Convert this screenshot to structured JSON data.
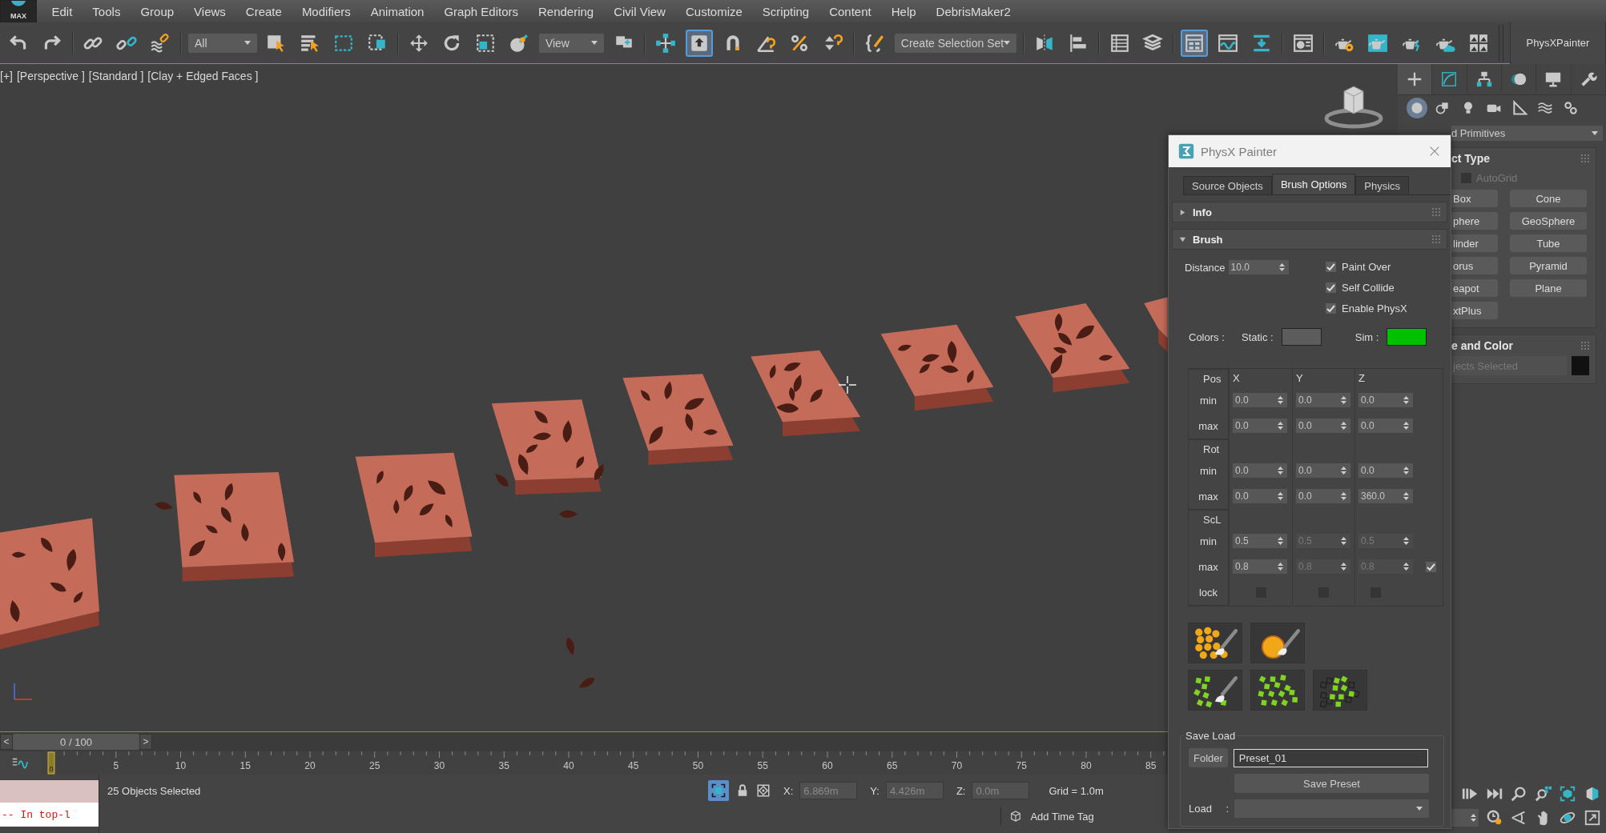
{
  "app_button": {
    "label": "MAX"
  },
  "menu_bar": [
    {
      "label": "Edit"
    },
    {
      "label": "Tools"
    },
    {
      "label": "Group"
    },
    {
      "label": "Views"
    },
    {
      "label": "Create"
    },
    {
      "label": "Modifiers"
    },
    {
      "label": "Animation"
    },
    {
      "label": "Graph Editors"
    },
    {
      "label": "Rendering"
    },
    {
      "label": "Civil View"
    },
    {
      "label": "Customize"
    },
    {
      "label": "Scripting"
    },
    {
      "label": "Content"
    },
    {
      "label": "Help"
    },
    {
      "label": "DebrisMaker2"
    }
  ],
  "main_toolbar": {
    "items": [
      {
        "kind": "icon",
        "selected": false
      },
      {
        "kind": "icon",
        "selected": false
      },
      {
        "kind": "separator"
      },
      {
        "kind": "icon",
        "selected": false
      },
      {
        "kind": "icon",
        "selected": false
      },
      {
        "kind": "icon",
        "selected": false
      },
      {
        "kind": "separator"
      },
      {
        "kind": "dropdown",
        "value": "All"
      },
      {
        "kind": "icon",
        "selected": false
      },
      {
        "kind": "icon",
        "selected": false
      },
      {
        "kind": "icon",
        "selected": false
      },
      {
        "kind": "icon",
        "selected": false
      },
      {
        "kind": "separator"
      },
      {
        "kind": "icon",
        "selected": false
      },
      {
        "kind": "icon",
        "selected": false
      },
      {
        "kind": "icon",
        "selected": false
      },
      {
        "kind": "icon",
        "selected": false
      },
      {
        "kind": "dropdown",
        "value": "View"
      },
      {
        "kind": "icon",
        "selected": false
      },
      {
        "kind": "separator"
      },
      {
        "kind": "icon",
        "selected": false
      },
      {
        "kind": "icon",
        "selected": true
      },
      {
        "kind": "icon",
        "selected": false
      },
      {
        "kind": "icon",
        "selected": false
      },
      {
        "kind": "icon",
        "selected": false
      },
      {
        "kind": "icon",
        "selected": false
      },
      {
        "kind": "separator"
      },
      {
        "kind": "icon",
        "selected": false
      },
      {
        "kind": "dropdown",
        "value": "Create Selection Set"
      },
      {
        "kind": "separator"
      },
      {
        "kind": "icon",
        "selected": false
      },
      {
        "kind": "icon",
        "selected": false
      },
      {
        "kind": "separator"
      },
      {
        "kind": "icon",
        "selected": false
      },
      {
        "kind": "icon",
        "selected": false
      },
      {
        "kind": "separator"
      },
      {
        "kind": "icon",
        "selected": true
      },
      {
        "kind": "icon",
        "selected": false
      },
      {
        "kind": "icon",
        "selected": false
      },
      {
        "kind": "separator"
      },
      {
        "kind": "icon",
        "selected": false
      },
      {
        "kind": "separator"
      },
      {
        "kind": "icon",
        "selected": false
      },
      {
        "kind": "icon",
        "selected": false
      },
      {
        "kind": "icon",
        "selected": false
      },
      {
        "kind": "icon",
        "selected": false
      },
      {
        "kind": "icon",
        "selected": false
      }
    ],
    "tab_label": "PhysXPainter"
  },
  "viewport": {
    "labels": [
      "[+]",
      "[Perspective ]",
      "[Standard ]",
      "[Clay + Edged Faces ]"
    ]
  },
  "command_panel": {
    "tabs": [
      {
        "selected": true
      },
      {
        "selected": false
      },
      {
        "selected": false
      },
      {
        "selected": false
      },
      {
        "selected": false
      },
      {
        "selected": false
      }
    ],
    "categories": [
      {
        "selected": true
      },
      {
        "selected": false
      },
      {
        "selected": false
      },
      {
        "selected": false
      },
      {
        "selected": false
      },
      {
        "selected": false
      },
      {
        "selected": false
      }
    ],
    "category_dropdown": "d Primitives",
    "object_type": {
      "title": "ct Type",
      "autogrid": {
        "label": "AutoGrid",
        "checked": false,
        "disabled": true
      },
      "buttons": [
        {
          "label": "Box"
        },
        {
          "label": "Cone"
        },
        {
          "label": "phere"
        },
        {
          "label": "GeoSphere"
        },
        {
          "label": "linder"
        },
        {
          "label": "Tube"
        },
        {
          "label": "orus"
        },
        {
          "label": "Pyramid"
        },
        {
          "label": "eapot"
        },
        {
          "label": "Plane"
        },
        {
          "label": "xtPlus"
        }
      ]
    },
    "name_color": {
      "title": "e and Color",
      "name_field": {
        "value": "jects Selected",
        "disabled": true
      },
      "color": "#111111"
    }
  },
  "physx_painter": {
    "title": "PhysX Painter",
    "tabs": [
      {
        "label": "Source Objects",
        "selected": false
      },
      {
        "label": "Brush Options",
        "selected": true
      },
      {
        "label": "Physics",
        "selected": false
      }
    ],
    "rollouts": [
      {
        "title": "Info",
        "expanded": false
      },
      {
        "title": "Brush",
        "expanded": true,
        "brush": {
          "distance": {
            "label": "Distance",
            "value": "10.0"
          },
          "options": [
            {
              "label": "Paint Over",
              "checked": true
            },
            {
              "label": "Self Collide",
              "checked": true
            },
            {
              "label": "Enable PhysX",
              "checked": true
            }
          ],
          "colors": {
            "label": "Colors :",
            "swatches": [
              {
                "label": "Static :",
                "color": "#5c5c5c"
              },
              {
                "label": "Sim :",
                "color": "#00c000"
              }
            ]
          },
          "limits": {
            "columns": [
              "X",
              "Y",
              "Z"
            ],
            "groups": [
              {
                "label": "Pos",
                "rows": [
                  {
                    "label": "min",
                    "values": [
                      {
                        "value": "0.0",
                        "disabled": false
                      },
                      {
                        "value": "0.0",
                        "disabled": false
                      },
                      {
                        "value": "0.0",
                        "disabled": false
                      }
                    ]
                  },
                  {
                    "label": "max",
                    "values": [
                      {
                        "value": "0.0",
                        "disabled": false
                      },
                      {
                        "value": "0.0",
                        "disabled": false
                      },
                      {
                        "value": "0.0",
                        "disabled": false
                      }
                    ]
                  }
                ]
              },
              {
                "label": "Rot",
                "rows": [
                  {
                    "label": "min",
                    "values": [
                      {
                        "value": "0.0",
                        "disabled": false
                      },
                      {
                        "value": "0.0",
                        "disabled": false
                      },
                      {
                        "value": "0.0",
                        "disabled": false
                      }
                    ]
                  },
                  {
                    "label": "max",
                    "values": [
                      {
                        "value": "0.0",
                        "disabled": false
                      },
                      {
                        "value": "0.0",
                        "disabled": false
                      },
                      {
                        "value": "360.0",
                        "disabled": false
                      }
                    ]
                  }
                ]
              },
              {
                "label": "ScL",
                "rows": [
                  {
                    "label": "min",
                    "values": [
                      {
                        "value": "0.5",
                        "disabled": false
                      },
                      {
                        "value": "0.5",
                        "disabled": true
                      },
                      {
                        "value": "0.5",
                        "disabled": true
                      }
                    ]
                  },
                  {
                    "label": "max",
                    "values": [
                      {
                        "value": "0.8",
                        "disabled": false
                      },
                      {
                        "value": "0.8",
                        "disabled": true
                      },
                      {
                        "value": "0.8",
                        "disabled": true
                      }
                    ],
                    "check": true
                  }
                ],
                "lock": {
                  "label": "lock",
                  "checks": [
                    {
                      "checked": false
                    },
                    {
                      "checked": false
                    },
                    {
                      "checked": false
                    }
                  ]
                }
              }
            ]
          },
          "tools": [
            [
              {
                "kind": "paint-dots"
              },
              {
                "kind": "paint-circle"
              }
            ],
            [
              {
                "kind": "paint-squares"
              },
              {
                "kind": "scatter-squares"
              },
              {
                "kind": "erase-squares"
              }
            ]
          ],
          "save_load": {
            "title": "Save Load",
            "folder_button": "Folder",
            "preset_name": "Preset_01",
            "save_button": "Save Preset",
            "load_label": "Load :"
          }
        }
      }
    ]
  },
  "timeline": {
    "prev": "<",
    "next": ">",
    "slider": {
      "label": "0 / 100",
      "level": 0
    },
    "current_frame": "0",
    "ticks": [
      "5",
      "10",
      "15",
      "20",
      "25",
      "30",
      "35",
      "40",
      "45",
      "50",
      "55",
      "60",
      "65",
      "70",
      "75",
      "80",
      "85"
    ]
  },
  "status_bar": {
    "listener_output": "-- In top-l",
    "prompt": "25 Objects Selected",
    "selection_lock": {
      "on": true
    },
    "coords": [
      {
        "label": "X:",
        "value": "6.869m"
      },
      {
        "label": "Y:",
        "value": "4.426m"
      },
      {
        "label": "Z:",
        "value": "0.0m"
      }
    ],
    "grid": "Grid = 1.0m",
    "time_tag": "Add Time Tag"
  }
}
